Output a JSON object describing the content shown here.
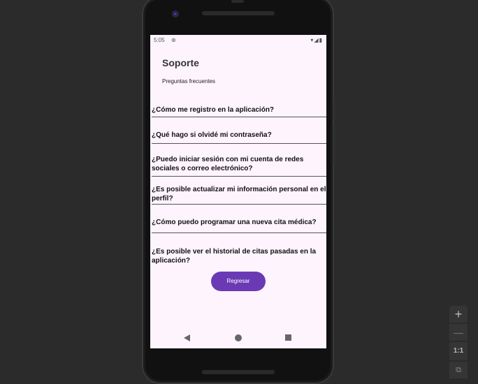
{
  "status_bar": {
    "time": "5:05",
    "sync_icon": "sync-icon",
    "icons": [
      "wifi-icon",
      "signal-icon",
      "battery-icon"
    ]
  },
  "screen": {
    "title": "Soporte",
    "subtitle": "Preguntas frecuentes",
    "faqs": [
      "¿Cómo me registro en la aplicación?",
      "¿Qué hago si olvidé mi contraseña?",
      "¿Puedo iniciar sesión con mi cuenta de redes sociales o correo electrónico?",
      "¿Es posible actualizar mi información personal en el perfil?",
      "¿Cómo puedo programar una nueva cita médica?",
      "¿Es posible ver el historial de citas pasadas en la aplicación?"
    ],
    "back_button": "Regresar"
  },
  "colors": {
    "screen_bg": "#fdf4fe",
    "accent": "#6a3ab5",
    "backdrop": "#2b2b2b"
  },
  "emulator_controls": {
    "zoom_in": "+",
    "zoom_out": "—",
    "one_to_one": "1:1",
    "fit_icon": "fit-screen-icon"
  }
}
